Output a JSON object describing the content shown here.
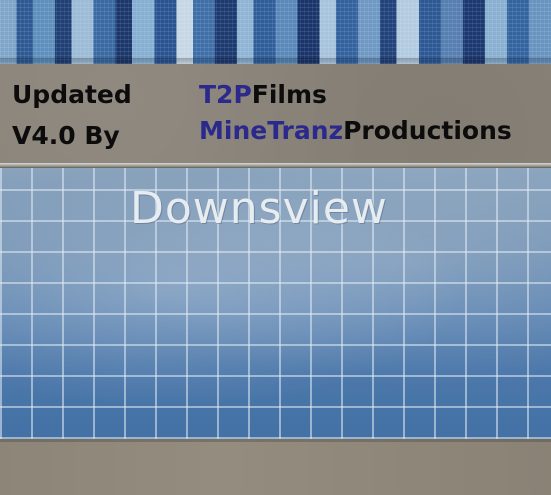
{
  "credits": {
    "line1": "Updated",
    "line2": "V4.0 By",
    "studio1_prefix": "T2P",
    "studio1_suffix": "Films",
    "studio2_prefix": "MineTranz",
    "studio2_suffix": "Productions"
  },
  "sign": {
    "station_name": "Downsview"
  },
  "colors": {
    "credit_text": "#0c0c0c",
    "credit_accent": "#2b2a8c",
    "tile_blue": "#5f86b2",
    "sign_lettering": "#e6ecf0"
  }
}
